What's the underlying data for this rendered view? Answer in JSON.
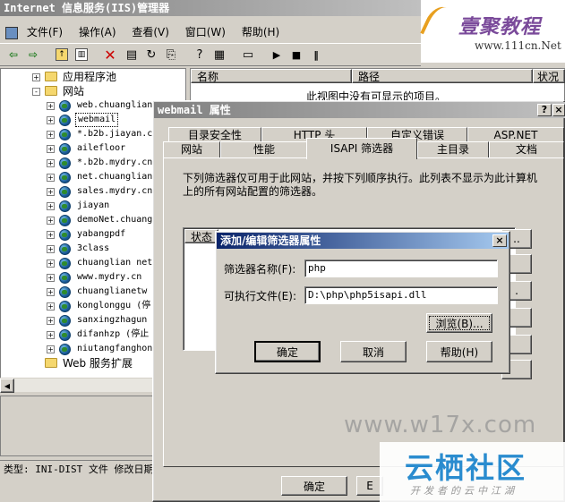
{
  "main_window": {
    "title": "Internet 信息服务(IIS)管理器",
    "menu": [
      "文件(F)",
      "操作(A)",
      "查看(V)",
      "窗口(W)",
      "帮助(H)"
    ]
  },
  "tree": {
    "items": [
      {
        "label": "应用程序池",
        "type": "folder",
        "expand": "+"
      },
      {
        "label": "网站",
        "type": "folder",
        "expand": "-"
      },
      {
        "label": "web.chuanglian",
        "type": "site",
        "expand": "+"
      },
      {
        "label": "webmail",
        "type": "site",
        "expand": "+",
        "selected": true
      },
      {
        "label": "*.b2b.jiayan.c",
        "type": "site",
        "expand": "+"
      },
      {
        "label": "ailefloor",
        "type": "site",
        "expand": "+"
      },
      {
        "label": "*.b2b.mydry.cn",
        "type": "site",
        "expand": "+"
      },
      {
        "label": "net.chuanglian",
        "type": "site",
        "expand": "+"
      },
      {
        "label": "sales.mydry.cn",
        "type": "site",
        "expand": "+"
      },
      {
        "label": "jiayan",
        "type": "site",
        "expand": "+"
      },
      {
        "label": "demoNet.chuang",
        "type": "site",
        "expand": "+"
      },
      {
        "label": "yabangpdf",
        "type": "site",
        "expand": "+"
      },
      {
        "label": "3class",
        "type": "site",
        "expand": "+"
      },
      {
        "label": "chuanglian net",
        "type": "site",
        "expand": "+"
      },
      {
        "label": "www.mydry.cn",
        "type": "site",
        "expand": "+"
      },
      {
        "label": "chuanglianetw",
        "type": "site",
        "expand": "+"
      },
      {
        "label": "konglonggu (停",
        "type": "site",
        "expand": "+"
      },
      {
        "label": "sanxingzhagun",
        "type": "site",
        "expand": "+"
      },
      {
        "label": "difanhzp (停止",
        "type": "site",
        "expand": "+"
      },
      {
        "label": "niutangfanghon",
        "type": "site",
        "expand": "+"
      },
      {
        "label": "Web 服务扩展",
        "type": "folder",
        "expand": ""
      }
    ]
  },
  "list_view": {
    "columns": [
      "名称",
      "路径",
      "状况"
    ],
    "empty_text": "此视图中没有可显示的项目。"
  },
  "status_bar": {
    "text": "类型: INI-DIST 文件 修改日期"
  },
  "props_dialog": {
    "title": "webmail 属性",
    "tabs_row1": [
      "目录安全性",
      "HTTP 头",
      "自定义错误",
      "ASP.NET"
    ],
    "tabs_row2": [
      "网站",
      "性能",
      "ISAPI 筛选器",
      "主目录",
      "文档"
    ],
    "active_tab": "ISAPI 筛选器",
    "description": "下列筛选器仅可用于此网站，并按下列顺序执行。此列表不显示为此计算机上的所有网站配置的筛选器。",
    "list_header": "状态",
    "ok_label": "确定"
  },
  "edit_dialog": {
    "title": "添加/编辑筛选器属性",
    "name_label": "筛选器名称(F):",
    "name_value": "php",
    "exe_label": "可执行文件(E):",
    "exe_value": "D:\\php\\php5isapi.dll",
    "browse_label": "浏览(B)...",
    "ok_label": "确定",
    "cancel_label": "取消",
    "help_label": "帮助(H)"
  },
  "watermarks": {
    "logo_text": "壹聚教程",
    "logo_url": "www.111cn.Net",
    "w17x": "www.w17x.com",
    "yunqi": "云栖社区",
    "yunqi_sub": "开发者的云中江湖"
  }
}
